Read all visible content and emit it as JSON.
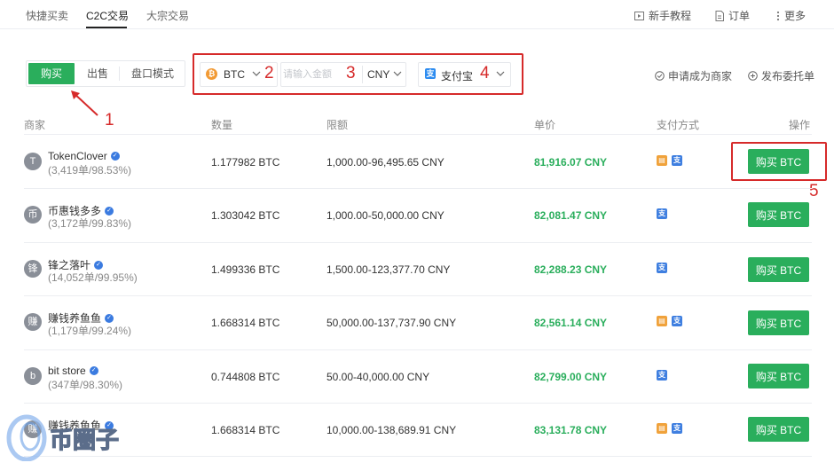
{
  "tabs": [
    {
      "label": "快捷买卖",
      "active": false
    },
    {
      "label": "C2C交易",
      "active": true
    },
    {
      "label": "大宗交易",
      "active": false
    }
  ],
  "top_links": {
    "tutorial": "新手教程",
    "orders": "订单",
    "more": "更多"
  },
  "mode": {
    "buy": "购买",
    "sell": "出售",
    "book": "盘口模式"
  },
  "filters": {
    "coin": "BTC",
    "amount_placeholder": "请输入金额",
    "currency": "CNY",
    "payment": "支付宝"
  },
  "actions": {
    "apply_merchant": "申请成为商家",
    "post_order": "发布委托单"
  },
  "annotations": [
    "1",
    "2",
    "3",
    "4",
    "5"
  ],
  "table": {
    "headers": {
      "merchant": "商家",
      "quantity": "数量",
      "limit": "限额",
      "price": "单价",
      "payment": "支付方式",
      "action": "操作"
    },
    "rows": [
      {
        "avatar": "T",
        "name": "TokenClover",
        "stats": "(3,419单/98.53%)",
        "quantity": "1.177982 BTC",
        "limit": "1,000.00-96,495.65 CNY",
        "price": "81,916.07 CNY",
        "pay": [
          "bank",
          "alipay"
        ],
        "button": "购买 BTC"
      },
      {
        "avatar": "币",
        "name": "币惠钱多多",
        "stats": "(3,172单/99.83%)",
        "quantity": "1.303042 BTC",
        "limit": "1,000.00-50,000.00 CNY",
        "price": "82,081.47 CNY",
        "pay": [
          "alipay"
        ],
        "button": "购买 BTC"
      },
      {
        "avatar": "锋",
        "name": "锋之落叶",
        "stats": "(14,052单/99.95%)",
        "quantity": "1.499336 BTC",
        "limit": "1,500.00-123,377.70 CNY",
        "price": "82,288.23 CNY",
        "pay": [
          "alipay"
        ],
        "button": "购买 BTC"
      },
      {
        "avatar": "赚",
        "name": "赚钱养鱼鱼",
        "stats": "(1,179单/99.24%)",
        "quantity": "1.668314 BTC",
        "limit": "50,000.00-137,737.90 CNY",
        "price": "82,561.14 CNY",
        "pay": [
          "bank",
          "alipay"
        ],
        "button": "购买 BTC"
      },
      {
        "avatar": "b",
        "name": "bit store",
        "stats": "(347单/98.30%)",
        "quantity": "0.744808 BTC",
        "limit": "50.00-40,000.00 CNY",
        "price": "82,799.00 CNY",
        "pay": [
          "alipay"
        ],
        "button": "购买 BTC"
      },
      {
        "avatar": "赚",
        "name": "赚钱养鱼鱼",
        "stats": "",
        "quantity": "1.668314 BTC",
        "limit": "10,000.00-138,689.91 CNY",
        "price": "83,131.78 CNY",
        "pay": [
          "bank",
          "alipay"
        ],
        "button": "购买 BTC"
      }
    ]
  },
  "watermark": "币圈子",
  "colors": {
    "accent_green": "#2aae5c",
    "annotation_red": "#d62a2a",
    "verified_blue": "#3b7be0",
    "alipay_blue": "#3f7fe0",
    "bank_orange": "#f0a23b",
    "btc_orange": "#f29a34"
  }
}
